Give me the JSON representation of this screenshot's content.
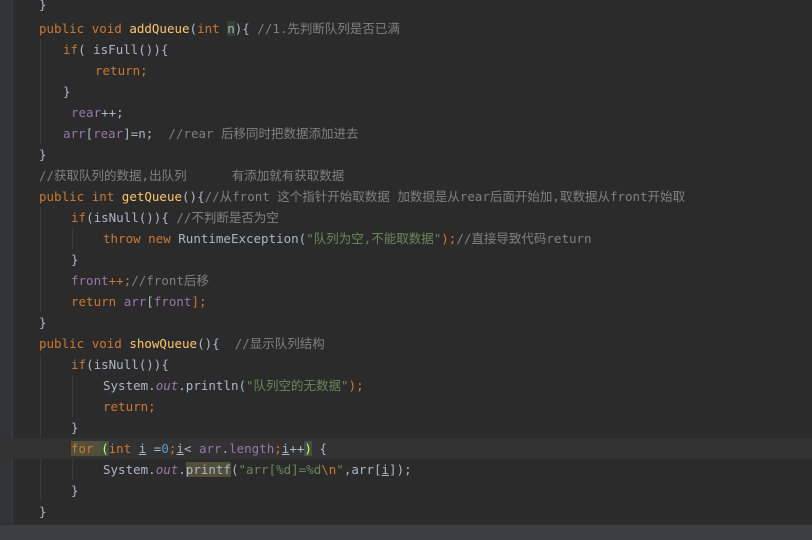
{
  "editor": {
    "language": "Java",
    "theme": "Darcula",
    "lines": [
      [
        [
          "}",
          "plain"
        ]
      ],
      [
        [
          "public ",
          "kw"
        ],
        [
          "void ",
          "kw"
        ],
        [
          "addQueue",
          "fn"
        ],
        [
          "(",
          "plain"
        ],
        [
          "int ",
          "kw"
        ],
        [
          "n",
          "plain hl-var"
        ],
        [
          "){ ",
          "plain"
        ],
        [
          "//1.先判断队列是否已满",
          "cm"
        ]
      ],
      [
        [
          "if",
          "kw"
        ],
        [
          "( isFull()){",
          "plain"
        ]
      ],
      [
        [
          "return;",
          "kw"
        ]
      ],
      [
        [
          "}",
          "plain"
        ]
      ],
      [
        [
          "rear",
          "fld"
        ],
        [
          "++;",
          "plain"
        ]
      ],
      [
        [
          "arr",
          "fld"
        ],
        [
          "[",
          "plain"
        ],
        [
          "rear",
          "fld"
        ],
        [
          "]=n;  ",
          "plain"
        ],
        [
          "//rear 后移同时把数据添加进去",
          "cm"
        ]
      ],
      [
        [
          "}",
          "plain"
        ]
      ],
      [
        [
          "//获取队列的数据,出队列      有添加就有获取数据",
          "cm"
        ]
      ],
      [
        [
          "public ",
          "kw"
        ],
        [
          "int ",
          "kw"
        ],
        [
          "getQueue",
          "fn"
        ],
        [
          "(){",
          "plain"
        ],
        [
          "//从front 这个指针开始取数据 加数据是从rear后面开始加,取数据从front开始取",
          "cm"
        ]
      ],
      [
        [
          "if",
          "kw"
        ],
        [
          "(isNull()){ ",
          "plain"
        ],
        [
          "//不判断是否为空",
          "cm"
        ]
      ],
      [
        [
          "throw ",
          "kw"
        ],
        [
          "new ",
          "kw"
        ],
        [
          "RuntimeException(",
          "plain"
        ],
        [
          "\"队列为空,不能取数据\"",
          "str"
        ],
        [
          ");",
          "kw"
        ],
        [
          "//直接导致代码return",
          "cm"
        ]
      ],
      [
        [
          "}",
          "plain"
        ]
      ],
      [
        [
          "front",
          "fld"
        ],
        [
          "++;",
          "kw"
        ],
        [
          "//front后移",
          "cm"
        ]
      ],
      [
        [
          "return ",
          "kw"
        ],
        [
          "arr",
          "fld"
        ],
        [
          "[",
          "plain"
        ],
        [
          "front",
          "fld"
        ],
        [
          "];",
          "kw"
        ]
      ],
      [
        [
          "}",
          "plain"
        ]
      ],
      [
        [
          "public ",
          "kw"
        ],
        [
          "void ",
          "kw"
        ],
        [
          "showQueue",
          "fn"
        ],
        [
          "(){  ",
          "plain"
        ],
        [
          "//显示队列结构",
          "cm"
        ]
      ],
      [
        [
          "if",
          "kw"
        ],
        [
          "(isNull()){",
          "plain"
        ]
      ],
      [
        [
          "System.",
          "plain"
        ],
        [
          "out",
          "fld-i"
        ],
        [
          ".println(",
          "plain"
        ],
        [
          "\"队列空的无数据\"",
          "str"
        ],
        [
          ");",
          "kw"
        ]
      ],
      [
        [
          "return;",
          "kw"
        ]
      ],
      [
        [
          "}",
          "plain"
        ]
      ],
      [
        [
          "for ",
          "kw warn-bg"
        ],
        [
          "(",
          "brace-hl"
        ],
        [
          "int ",
          "kw"
        ],
        [
          "i",
          "plain underline"
        ],
        [
          " =",
          "plain"
        ],
        [
          "0",
          "num"
        ],
        [
          ";",
          "kw"
        ],
        [
          "i",
          "plain underline"
        ],
        [
          "< ",
          "plain"
        ],
        [
          "arr",
          "fld"
        ],
        [
          ".",
          "plain"
        ],
        [
          "length",
          "fld"
        ],
        [
          ";",
          "kw"
        ],
        [
          "i",
          "plain underline"
        ],
        [
          "++",
          "plain"
        ],
        [
          ")",
          "brace-hl"
        ],
        [
          " {",
          "plain"
        ]
      ],
      [
        [
          "System.",
          "plain"
        ],
        [
          "out",
          "fld-i"
        ],
        [
          ".",
          "plain"
        ],
        [
          "printf",
          "plain warn-bg"
        ],
        [
          "(",
          "plain"
        ],
        [
          "\"arr[%d]=%d",
          "str"
        ],
        [
          "\\n",
          "kw"
        ],
        [
          "\"",
          "str"
        ],
        [
          ",arr[",
          "plain"
        ],
        [
          "i",
          "plain underline"
        ],
        [
          "]);",
          "plain"
        ]
      ],
      [
        [
          "}",
          "plain"
        ]
      ],
      [
        [
          "}",
          "plain"
        ]
      ]
    ]
  }
}
